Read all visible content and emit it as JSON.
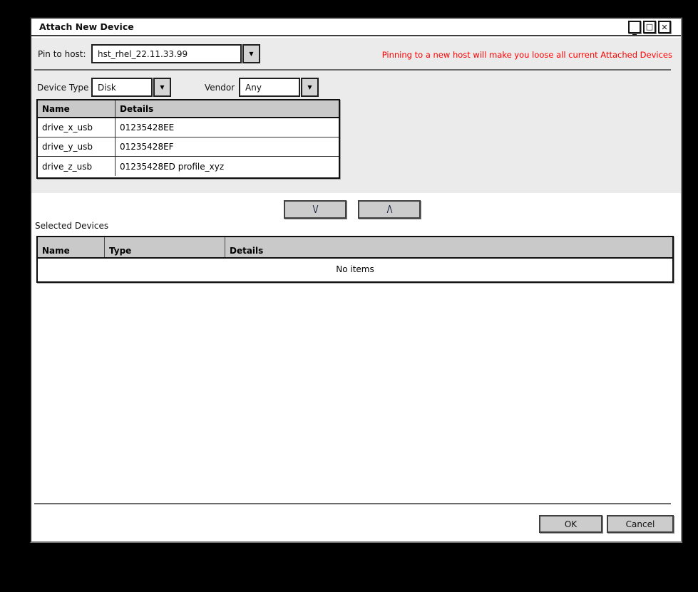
{
  "window": {
    "title": "Attach New Device"
  },
  "icons": {
    "minimize": "_",
    "maximize": "□",
    "close": "✕",
    "dropdown": "▼"
  },
  "pin": {
    "label": "Pin to host:",
    "value": "hst_rhel_22.11.33.99",
    "warning": "Pinning to a new host will make you loose all current Attached Devices"
  },
  "filters": {
    "device_type_label": "Device Type",
    "device_type_value": "Disk",
    "vendor_label": "Vendor",
    "vendor_value": "Any"
  },
  "available": {
    "columns": [
      "Name",
      "Details"
    ],
    "rows": [
      {
        "name": "drive_x_usb",
        "details": "01235428EE"
      },
      {
        "name": "drive_y_usb",
        "details": "01235428EF"
      },
      {
        "name": "drive_z_usb",
        "details": "01235428ED profile_xyz"
      }
    ]
  },
  "move_buttons": {
    "down": "\\/",
    "up": "/\\"
  },
  "selected": {
    "label": "Selected Devices",
    "columns": [
      "Name",
      "Type",
      "Details"
    ],
    "empty_text": "No items"
  },
  "footer": {
    "ok_label": "OK",
    "cancel_label": "Cancel"
  },
  "colors": {
    "warning_text": "#ff0000",
    "panel_bg": "#ebebeb",
    "table_header_bg": "#c9c9c9",
    "button_bg": "#cccccc"
  }
}
